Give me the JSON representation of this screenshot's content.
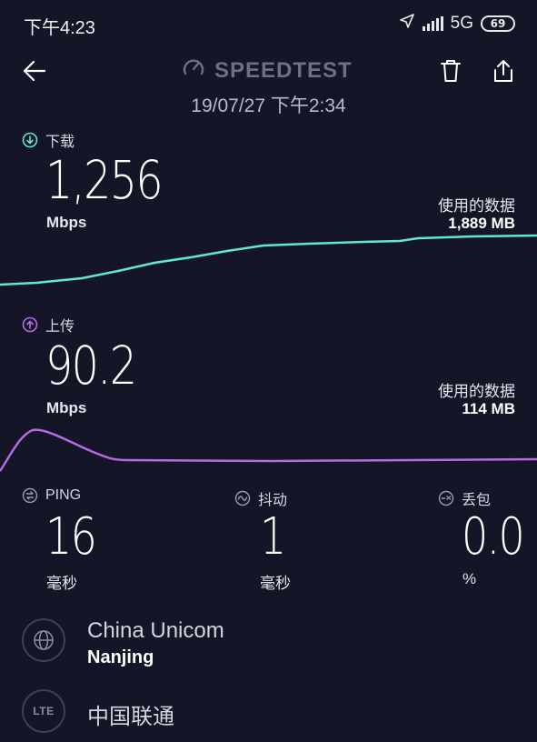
{
  "status_bar": {
    "time": "下午4:23",
    "network": "5G",
    "battery": "69"
  },
  "header": {
    "title": "SPEEDTEST",
    "datetime": "19/07/27 下午2:34"
  },
  "download": {
    "label": "下载",
    "value": "1,256",
    "unit": "Mbps",
    "data_used_label": "使用的数据",
    "data_used_value": "1,889 MB"
  },
  "upload": {
    "label": "上传",
    "value": "90.2",
    "unit": "Mbps",
    "data_used_label": "使用的数据",
    "data_used_value": "114 MB"
  },
  "stats": {
    "ping": {
      "label": "PING",
      "value": "16",
      "unit": "毫秒"
    },
    "jitter": {
      "label": "抖动",
      "value": "1",
      "unit": "毫秒"
    },
    "loss": {
      "label": "丢包",
      "value": "0.0",
      "unit": "%"
    }
  },
  "provider": {
    "name": "China Unicom",
    "city": "Nanjing",
    "carrier_icon": "LTE",
    "carrier": "中国联通"
  },
  "colors": {
    "background": "#141526",
    "download_accent": "#5ee8d8",
    "upload_accent": "#b56be6",
    "muted": "#6c6f86"
  }
}
